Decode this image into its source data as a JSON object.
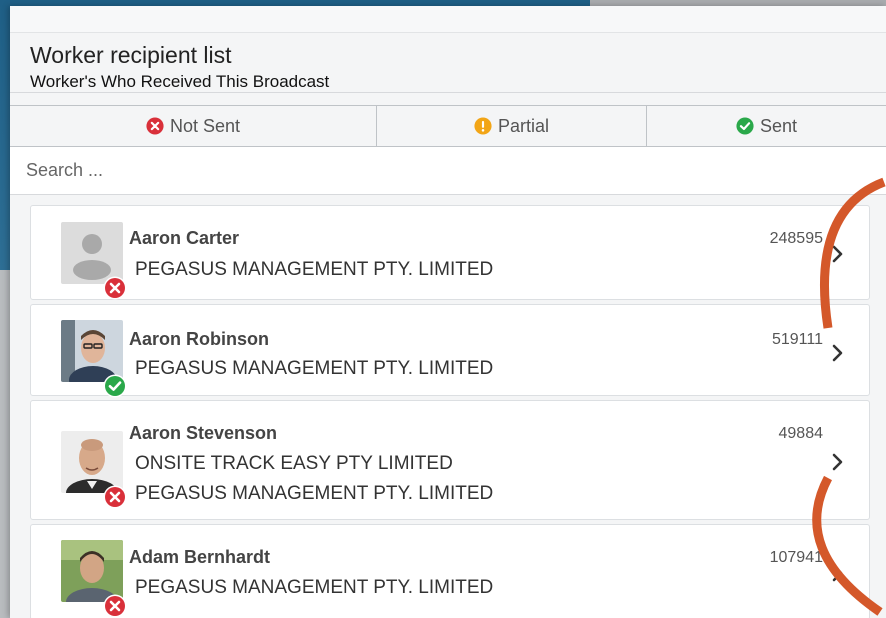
{
  "header": {
    "title": "Worker recipient list",
    "subtitle": "Worker's Who Received This Broadcast"
  },
  "tabs": [
    {
      "label": "Not Sent",
      "icon": "x-circle-icon",
      "color": "#d9303a"
    },
    {
      "label": "Partial",
      "icon": "exclamation-circle-icon",
      "color": "#f2a516"
    },
    {
      "label": "Sent",
      "icon": "check-circle-icon",
      "color": "#2aa84a"
    }
  ],
  "search": {
    "placeholder": "Search ..."
  },
  "workers": [
    {
      "name": "Aaron Carter",
      "id": "248595",
      "companies": [
        "PEGASUS MANAGEMENT PTY. LIMITED"
      ],
      "status": "not-sent",
      "avatar": "default-avatar-icon"
    },
    {
      "name": "Aaron Robinson",
      "id": "519111",
      "companies": [
        "PEGASUS MANAGEMENT PTY. LIMITED"
      ],
      "status": "sent",
      "avatar": "photo"
    },
    {
      "name": "Aaron Stevenson",
      "id": "49884",
      "companies": [
        "ONSITE TRACK EASY PTY LIMITED",
        "PEGASUS MANAGEMENT PTY. LIMITED"
      ],
      "status": "not-sent",
      "avatar": "photo"
    },
    {
      "name": "Adam Bernhardt",
      "id": "107941",
      "companies": [
        "PEGASUS MANAGEMENT PTY. LIMITED"
      ],
      "status": "not-sent",
      "avatar": "photo"
    }
  ],
  "colors": {
    "not_sent": "#d9303a",
    "sent": "#2aa84a",
    "partial": "#f2a516",
    "annotation": "#d4582a"
  }
}
